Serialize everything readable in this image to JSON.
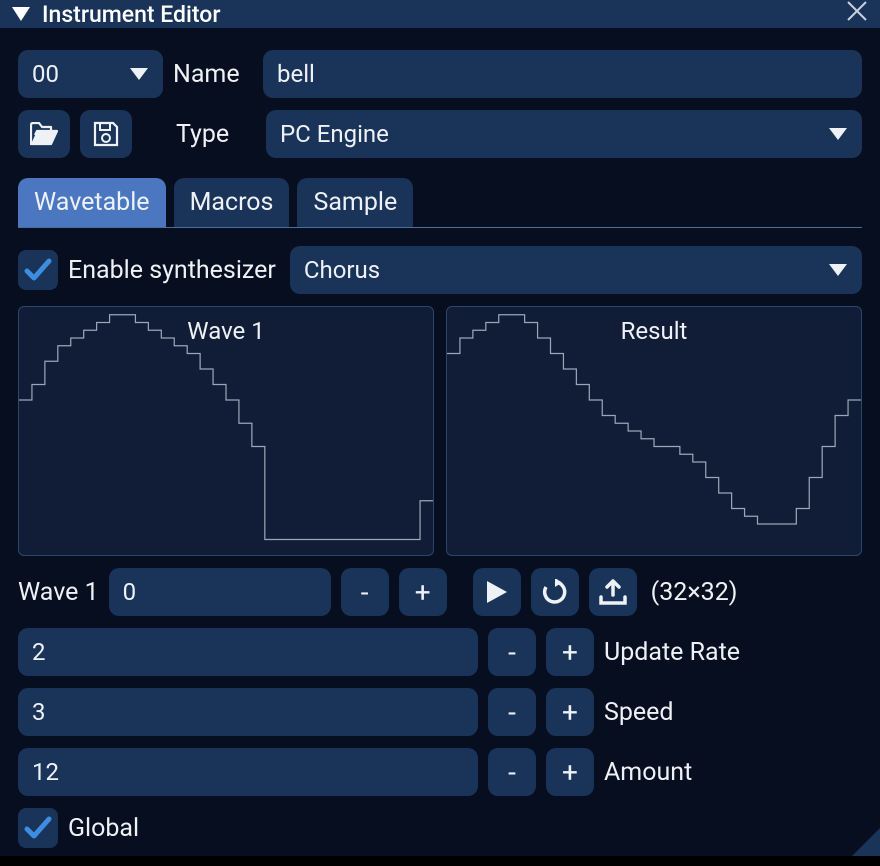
{
  "window": {
    "title": "Instrument Editor"
  },
  "instrument": {
    "number": "00",
    "name_label": "Name",
    "name_value": "bell",
    "type_label": "Type",
    "type_value": "PC Engine"
  },
  "tabs": {
    "wavetable": "Wavetable",
    "macros": "Macros",
    "sample": "Sample"
  },
  "synth": {
    "enable_label": "Enable synthesizer",
    "enabled": true,
    "mode": "Chorus"
  },
  "wave_panels": {
    "wave1_title": "Wave 1",
    "result_title": "Result"
  },
  "wave_select": {
    "label": "Wave 1",
    "value": "0",
    "dimensions": "(32×32)"
  },
  "params": {
    "update_rate": {
      "value": "2",
      "label": "Update Rate"
    },
    "speed": {
      "value": "3",
      "label": "Speed"
    },
    "amount": {
      "value": "12",
      "label": "Amount"
    }
  },
  "global": {
    "label": "Global",
    "checked": true
  },
  "buttons": {
    "minus": "-",
    "plus": "+"
  },
  "icons": {
    "caret_down": "caret-down",
    "close": "close",
    "open": "folder-open",
    "save": "save",
    "play": "play",
    "reload": "reload",
    "upload": "upload",
    "check": "check"
  },
  "chart_data": [
    {
      "type": "line",
      "title": "Wave 1",
      "xlabel": "",
      "ylabel": "",
      "x": [
        0,
        1,
        2,
        3,
        4,
        5,
        6,
        7,
        8,
        9,
        10,
        11,
        12,
        13,
        14,
        15,
        16,
        17,
        18,
        19,
        20,
        21,
        22,
        23,
        24,
        25,
        26,
        27,
        28,
        29,
        30,
        31
      ],
      "values": [
        20,
        22,
        25,
        27,
        28,
        29,
        30,
        31,
        31,
        30,
        29,
        28,
        27,
        26,
        24,
        22,
        20,
        17,
        14,
        2,
        2,
        2,
        2,
        2,
        2,
        2,
        2,
        2,
        2,
        2,
        2,
        7
      ],
      "ylim": [
        0,
        32
      ],
      "xlim": [
        0,
        32
      ]
    },
    {
      "type": "line",
      "title": "Result",
      "xlabel": "",
      "ylabel": "",
      "x": [
        0,
        1,
        2,
        3,
        4,
        5,
        6,
        7,
        8,
        9,
        10,
        11,
        12,
        13,
        14,
        15,
        16,
        17,
        18,
        19,
        20,
        21,
        22,
        23,
        24,
        25,
        26,
        27,
        28,
        29,
        30,
        31
      ],
      "values": [
        26,
        28,
        29,
        30,
        31,
        31,
        30,
        28,
        26,
        24,
        22,
        20,
        18,
        17,
        16,
        15,
        14,
        14,
        13,
        12,
        10,
        8,
        6,
        5,
        4,
        4,
        4,
        6,
        10,
        14,
        18,
        20
      ],
      "ylim": [
        0,
        32
      ],
      "xlim": [
        0,
        32
      ]
    }
  ]
}
